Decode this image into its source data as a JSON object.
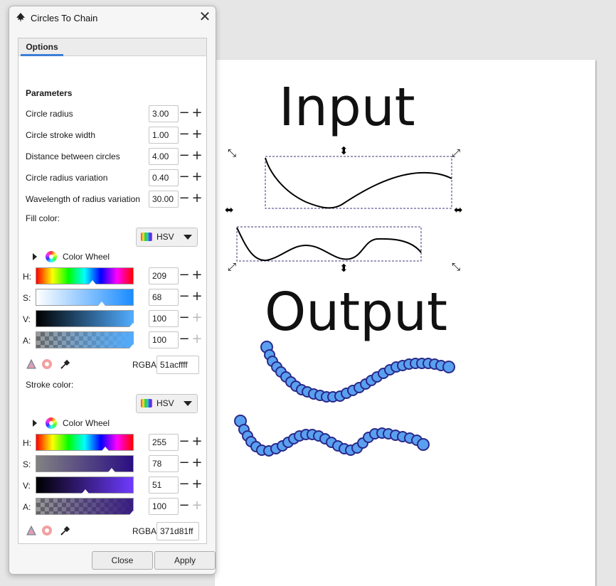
{
  "dialog": {
    "title": "Circles To Chain",
    "close_icon": "close-icon",
    "tab_label": "Options",
    "section_title": "Parameters",
    "params": [
      {
        "label": "Circle radius",
        "value": "3.00"
      },
      {
        "label": "Circle stroke width",
        "value": "1.00"
      },
      {
        "label": "Distance between circles",
        "value": "4.00"
      },
      {
        "label": "Circle radius variation",
        "value": "0.40"
      },
      {
        "label": "Wavelength of radius variation",
        "value": "30.00"
      }
    ],
    "fill": {
      "label": "Fill color:",
      "mode": "HSV",
      "wheel_label": "Color Wheel",
      "h_label": "H:",
      "h": "209",
      "s_label": "S:",
      "s": "68",
      "v_label": "V:",
      "v": "100",
      "a_label": "A:",
      "a": "100",
      "levels": {
        "h": 0.58,
        "s": 0.68,
        "v": 1.0,
        "a": 1.0
      },
      "rgba_label": "RGBA:",
      "rgba": "51acffff",
      "color": "#51acff"
    },
    "stroke": {
      "label": "Stroke color:",
      "mode": "HSV",
      "wheel_label": "Color Wheel",
      "h_label": "H:",
      "h": "255",
      "s_label": "S:",
      "s": "78",
      "v_label": "V:",
      "v": "51",
      "a_label": "A:",
      "a": "100",
      "levels": {
        "h": 0.71,
        "s": 0.78,
        "v": 0.51,
        "a": 1.0
      },
      "rgba_label": "RGBA:",
      "rgba": "371d81ff",
      "color": "#371d81"
    },
    "close_button": "Close",
    "apply_button": "Apply"
  },
  "canvas": {
    "input_label": "Input",
    "output_label": "Output",
    "circle_fill": "#5aa0f0",
    "circle_stroke": "#2a2a8a"
  }
}
